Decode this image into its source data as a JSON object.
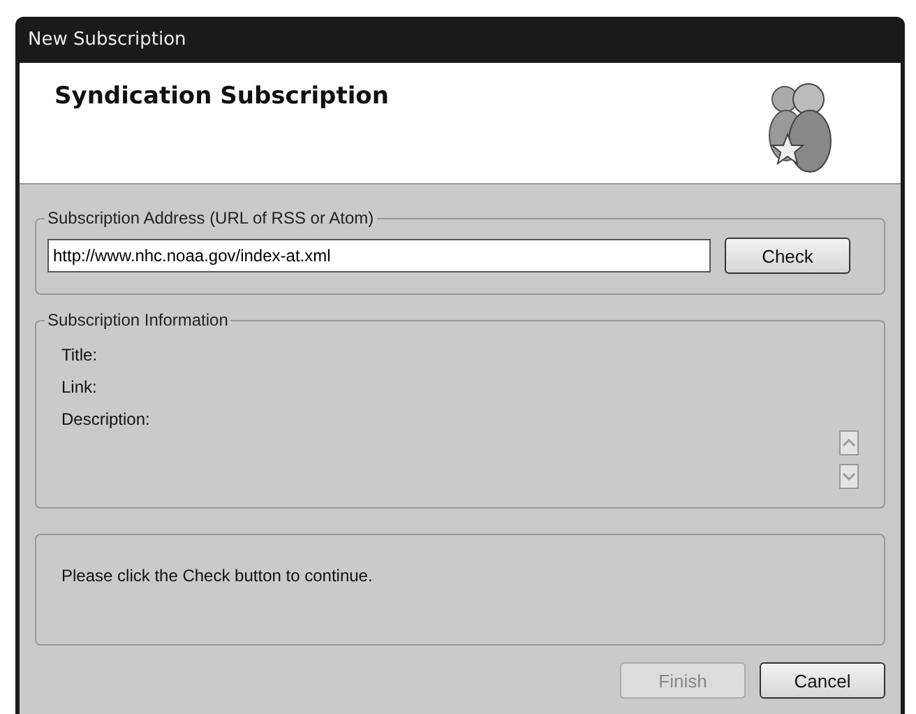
{
  "window": {
    "title": "New Subscription"
  },
  "header": {
    "title": "Syndication Subscription"
  },
  "address_group": {
    "legend": "Subscription Address (URL of RSS or Atom)",
    "url": "http://www.nhc.noaa.gov/index-at.xml",
    "check_button": {
      "label": "Check",
      "disabled": false
    }
  },
  "info_group": {
    "legend": "Subscription Information",
    "fields": [
      {
        "label": "Title:"
      },
      {
        "label": "Link:"
      },
      {
        "label": "Description:"
      }
    ]
  },
  "message": "Please click the Check button to continue.",
  "buttons": [
    {
      "label": "Finish",
      "disabled": true
    },
    {
      "label": "Cancel",
      "disabled": false
    }
  ]
}
